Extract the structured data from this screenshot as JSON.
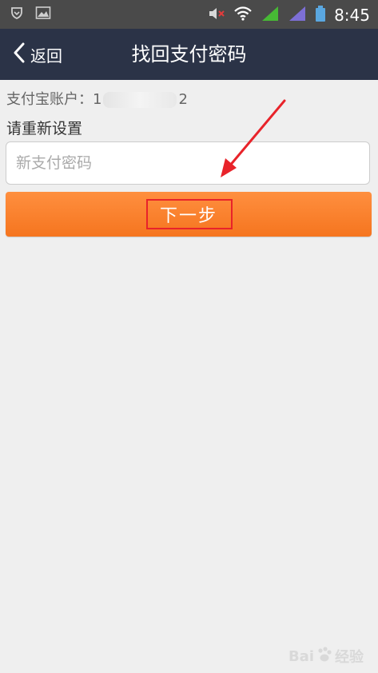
{
  "status_bar": {
    "time": "8:45"
  },
  "nav": {
    "back_label": "返回",
    "title": "找回支付密码"
  },
  "account": {
    "label": "支付宝账户：",
    "prefix": "1",
    "suffix": "2"
  },
  "form": {
    "section_label": "请重新设置",
    "password_placeholder": "新支付密码"
  },
  "actions": {
    "next_label": "下一步"
  },
  "watermark": {
    "brand_left": "Bai",
    "brand_right": "经验"
  },
  "colors": {
    "nav_bg": "#2b3347",
    "accent": "#f5751f",
    "highlight": "#e8232a"
  }
}
